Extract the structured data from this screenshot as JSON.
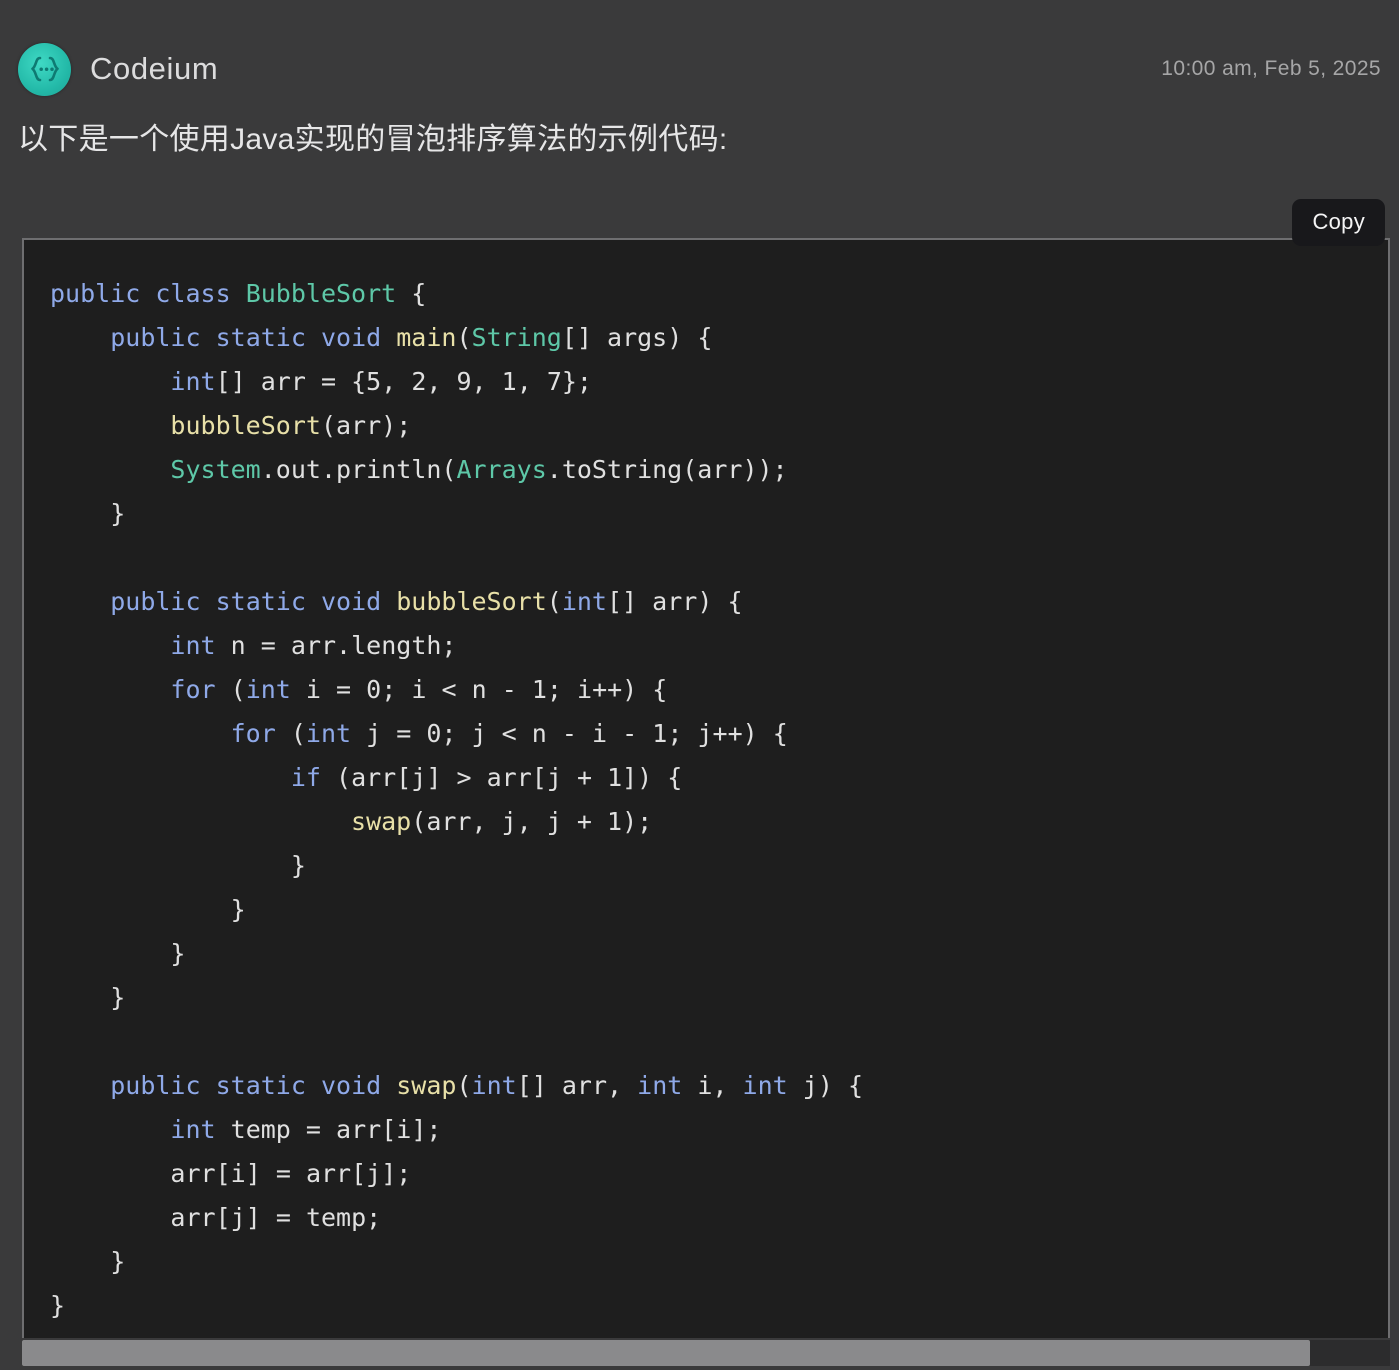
{
  "header": {
    "avatar_icon": "codeium-braces-icon",
    "agent_name": "Codeium",
    "timestamp": "10:00 am, Feb 5, 2025"
  },
  "message": {
    "intro_text": "以下是一个使用Java实现的冒泡排序算法的示例代码:"
  },
  "code_block": {
    "copy_label": "Copy",
    "language": "java",
    "source": "public class BubbleSort {\n    public static void main(String[] args) {\n        int[] arr = {5, 2, 9, 1, 7};\n        bubbleSort(arr);\n        System.out.println(Arrays.toString(arr));\n    }\n\n    public static void bubbleSort(int[] arr) {\n        int n = arr.length;\n        for (int i = 0; i < n - 1; i++) {\n            for (int j = 0; j < n - i - 1; j++) {\n                if (arr[j] > arr[j + 1]) {\n                    swap(arr, j, j + 1);\n                }\n            }\n        }\n    }\n\n    public static void swap(int[] arr, int i, int j) {\n        int temp = arr[i];\n        arr[i] = arr[j];\n        arr[j] = temp;\n    }\n}"
  },
  "colors": {
    "page_background": "#3a3a3b",
    "code_background": "#1e1e1e",
    "code_border": "#6e6e70",
    "avatar_accent": "#2bc4b0",
    "keyword": "#8fa9e8",
    "type": "#5ec8a8",
    "function": "#e8e0a8",
    "plain": "#e0e0e0",
    "copy_button_background": "#18181b",
    "scrollbar_thumb": "#8a8a8c"
  },
  "scrollbar": {
    "orientation": "horizontal",
    "thumb_fraction_percent": 94
  }
}
